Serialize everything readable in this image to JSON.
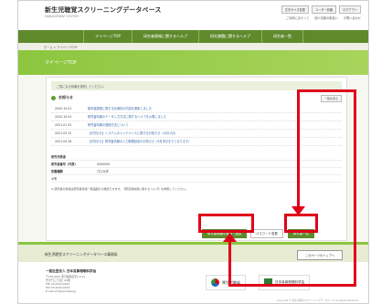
{
  "header": {
    "title": "新生児聴覚スクリーニングデータベース",
    "subtitle": "MANAGEMENT SYSTEM",
    "top_buttons": [
      "文字サイズ変更",
      "ユーザー情報",
      "ログアウト"
    ],
    "top_links": [
      "ご利用にあたって",
      "個人情報の取扱い",
      "お問い合わせ"
    ]
  },
  "nav": {
    "items": [
      "マイページTOP",
      "研究者情報に関するヘルプ",
      "研究課題に関するヘルプ",
      "研究者一覧"
    ]
  },
  "breadcrumb": "ホーム > マイページTOP",
  "banner_title": "マイページTOP",
  "alert_text": "ご覧になる情報を選択してください。",
  "notices": {
    "title": "お知らせ",
    "more_label": "一覧を見る",
    "rows": [
      {
        "date": "2020.10.01",
        "text": "新年度調査に関する仕様書の内容を更新しました"
      },
      {
        "date": "2020.10.01",
        "text": "研究者情報のデータ入力方法に関するヘルプを公開しました"
      },
      {
        "date": "2021.01.25",
        "text": "研究者情報の登録方法について"
      },
      {
        "date": "2021.03.12",
        "text": "【お知らせ】システムのメンテナンスに関するお知らせ（4月12日）"
      },
      {
        "date": "2021.04.16",
        "text": "【お知らせ】研究者情報の入力期限延長のお知らせ（9月末日までとなります）"
      }
    ]
  },
  "info_rows": [
    {
      "key": "研究代表者",
      "value": ""
    },
    {
      "key": "研究者番号（代表）",
      "value": "0000000"
    },
    {
      "key": "所属機関",
      "value": "〇〇大学"
    },
    {
      "key": "メモ",
      "value": ""
    }
  ],
  "foot_note": "※ 研究者の情報は研究者情報一覧画面から確認できます。【研究者情報に関するヘルプ】を参照してください。",
  "buttons": {
    "researcher_info": "研究者情報の登録・閲覧",
    "password_change": "パスワード変更",
    "researcher_list": "研究者一覧"
  },
  "footer_band": {
    "title": "新生児聴覚スクリーニングデータベース事務局",
    "button": "このページのトップへ"
  },
  "footer": {
    "org": "一般社団法人 日本耳鼻咽喉科学会",
    "lines": [
      "〒105-0014 東京都港区芝2-3-11",
      "芝大門三丁目ビル5階",
      "TEL 03-XXXX-XXXX",
      "FAX 03-XXXX-XXXX",
      "E-mail info@example.jp"
    ],
    "logo1": "厚生労働省",
    "logo2": "日本耳鼻咽喉科学会",
    "copyright": "Copyright © 新生児聴覚スクリーニングデータベース All Rights Reserved."
  },
  "colors": {
    "nav_green": "#5e8a2c",
    "banner_green": "#8cc63f",
    "highlight_red": "#e0001a"
  }
}
